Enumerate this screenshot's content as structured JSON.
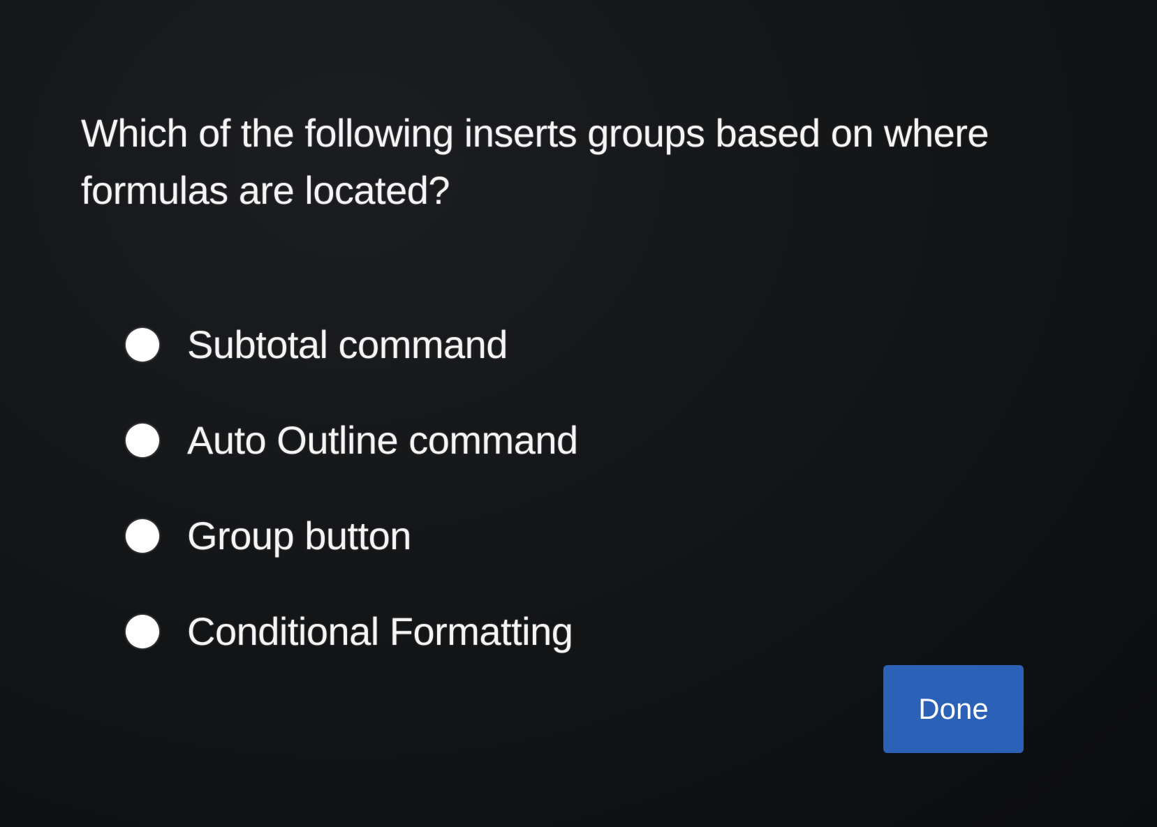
{
  "question": {
    "text": "Which of the following inserts groups based on where formulas are located?"
  },
  "options": [
    {
      "label": "Subtotal command",
      "selected": false
    },
    {
      "label": "Auto Outline command",
      "selected": false
    },
    {
      "label": "Group button",
      "selected": false
    },
    {
      "label": "Conditional Formatting",
      "selected": false
    }
  ],
  "done_button": {
    "label": "Done",
    "color": "#2b62b8"
  },
  "colors": {
    "background": "#121416",
    "text": "#f4f4f4",
    "radio": "#ffffff"
  }
}
